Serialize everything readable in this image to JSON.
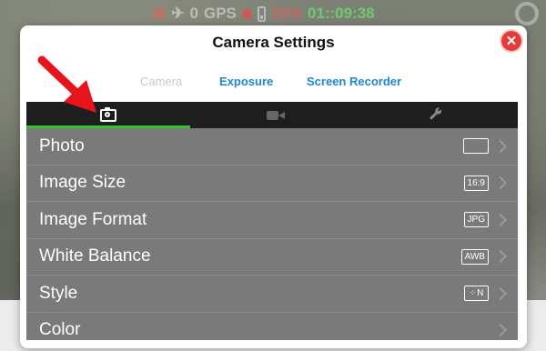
{
  "status_bar": {
    "satellites": "0",
    "gps_label": "GPS",
    "battery": "29%",
    "flight_time": "01::09:38"
  },
  "modal": {
    "title": "Camera Settings",
    "close_icon": "close-icon"
  },
  "text_tabs": [
    {
      "label": "Camera",
      "state": "disabled"
    },
    {
      "label": "Exposure",
      "state": "link"
    },
    {
      "label": "Screen Recorder",
      "state": "link"
    }
  ],
  "icon_tabs": [
    {
      "icon": "camera-icon",
      "active": true
    },
    {
      "icon": "video-icon",
      "active": false
    },
    {
      "icon": "wrench-icon",
      "active": false
    }
  ],
  "settings": [
    {
      "label": "Photo",
      "value": ""
    },
    {
      "label": "Image Size",
      "value": "16:9"
    },
    {
      "label": "Image Format",
      "value": "JPG"
    },
    {
      "label": "White Balance",
      "value": "AWB"
    },
    {
      "label": "Style",
      "value": "N"
    },
    {
      "label": "Color",
      "value": ""
    }
  ],
  "colors": {
    "accent_green": "#26c926",
    "link_blue": "#1d86d6",
    "close_red": "#e53a3a",
    "annotation_arrow": "#e8141c"
  }
}
